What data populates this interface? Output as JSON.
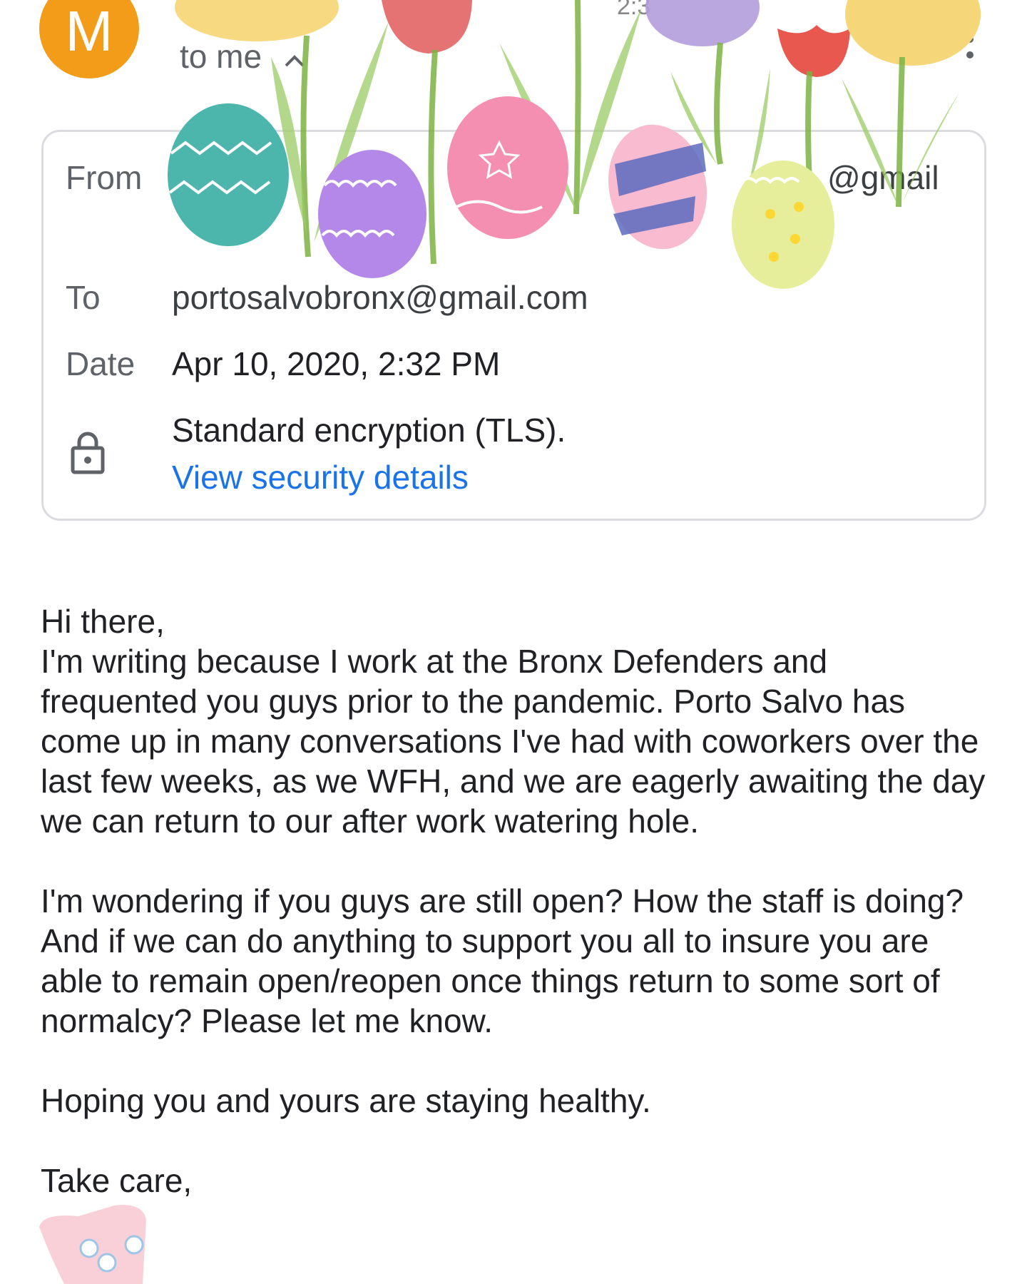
{
  "header": {
    "avatar_letter": "M",
    "time_fragment": "2:3",
    "recipient_toggle": "to me",
    "chevron": "^"
  },
  "details": {
    "from_label": "From",
    "from_value_visible": "@gmail",
    "to_label": "To",
    "to_value": "portosalvobronx@gmail.com",
    "date_label": "Date",
    "date_value": "Apr 10, 2020, 2:32 PM",
    "encryption_text": "Standard encryption (TLS).",
    "security_link": "View security details"
  },
  "body": {
    "greeting": "Hi there,",
    "paragraph1": "I'm writing because I work at the Bronx Defenders and frequented you guys prior to the pandemic. Porto Salvo has come up in many conversations I've had with coworkers over the last few weeks, as we WFH, and we are eagerly awaiting the day we can return to our after work watering hole.",
    "paragraph2": "I'm wondering if you guys are still open? How the staff is doing? And if we can do anything to support you all to insure you are able to remain open/reopen once things return to some sort of normalcy? Please let me know.",
    "paragraph3": "Hoping you and yours are staying healthy.",
    "signoff": "Take care,"
  },
  "icons": [
    "avatar",
    "chevron-up-icon",
    "more-vert-icon",
    "lock-icon",
    "tulip-sticker",
    "easter-egg-sticker",
    "bunny-sticker"
  ],
  "colors": {
    "avatar": "#f39c1a",
    "link": "#1a73e8",
    "card_border": "#dadce0",
    "label": "#5f6368"
  }
}
